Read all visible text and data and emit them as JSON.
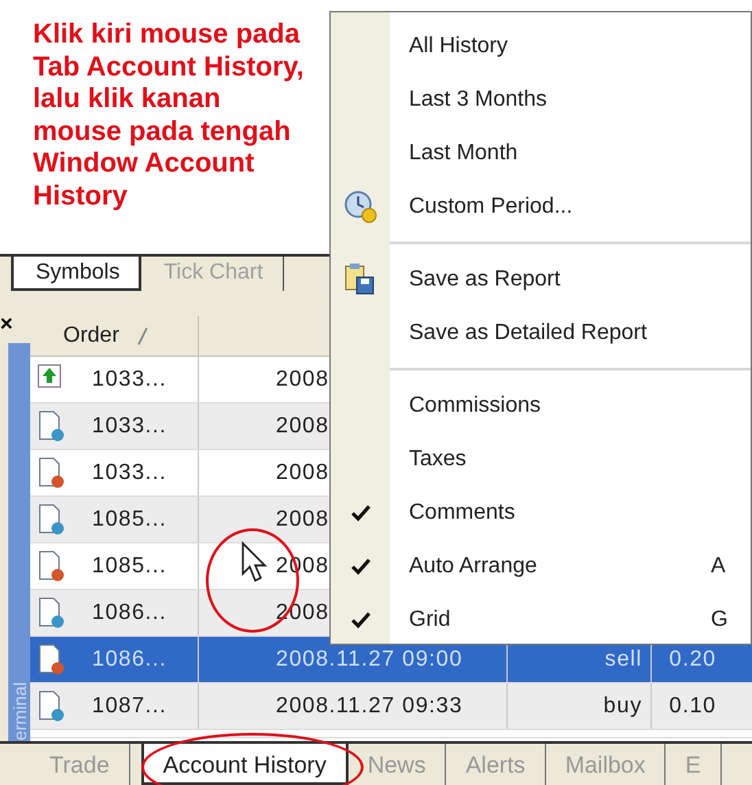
{
  "annotation": {
    "text": "Klik kiri mouse pada Tab Account History, lalu klik kanan mouse pada tengah Window Account History"
  },
  "top_tabs": [
    {
      "label": "Symbols",
      "selected": true
    },
    {
      "label": "Tick Chart",
      "selected": false
    }
  ],
  "terminal": {
    "close": "×",
    "side_label": "erminal"
  },
  "table": {
    "columns": [
      {
        "label": "Order"
      }
    ],
    "rows": [
      {
        "kind": "balance",
        "selected": false,
        "order": "1033...",
        "time": "2008"
      },
      {
        "kind": "blue",
        "selected": false,
        "order": "1033...",
        "time": "2008"
      },
      {
        "kind": "red",
        "selected": false,
        "order": "1033...",
        "time": "2008"
      },
      {
        "kind": "blue",
        "selected": false,
        "order": "1085...",
        "time": "2008"
      },
      {
        "kind": "red",
        "selected": false,
        "order": "1085...",
        "time": "2008"
      },
      {
        "kind": "blue",
        "selected": false,
        "order": "1086...",
        "time": "2008"
      },
      {
        "kind": "red",
        "selected": true,
        "order": "1086...",
        "time": "2008.11.27 09:00",
        "type": "sell",
        "size": "0.20"
      },
      {
        "kind": "blue",
        "selected": false,
        "order": "1087...",
        "time": "2008.11.27 09:33",
        "type": "buy",
        "size": "0.10"
      }
    ]
  },
  "bottom_tabs": [
    {
      "label": "Trade",
      "selected": false
    },
    {
      "label": "Account History",
      "selected": true
    },
    {
      "label": "News",
      "selected": false
    },
    {
      "label": "Alerts",
      "selected": false
    },
    {
      "label": "Mailbox",
      "selected": false
    },
    {
      "label": "E",
      "selected": false
    }
  ],
  "context_menu": {
    "items": [
      {
        "kind": "plain",
        "label": "All History"
      },
      {
        "kind": "plain",
        "label": "Last 3 Months"
      },
      {
        "kind": "plain",
        "label": "Last Month"
      },
      {
        "kind": "clock",
        "label": "Custom Period..."
      },
      {
        "kind": "separator"
      },
      {
        "kind": "report",
        "label": "Save as Report"
      },
      {
        "kind": "plain",
        "label": "Save as Detailed Report"
      },
      {
        "kind": "separator"
      },
      {
        "kind": "plain",
        "label": "Commissions",
        "checked": false
      },
      {
        "kind": "plain",
        "label": "Taxes",
        "checked": false
      },
      {
        "kind": "plain",
        "label": "Comments",
        "checked": true
      },
      {
        "kind": "plain",
        "label": "Auto Arrange",
        "checked": true,
        "shortcut": "A"
      },
      {
        "kind": "plain",
        "label": "Grid",
        "checked": true,
        "shortcut": "G"
      }
    ]
  }
}
